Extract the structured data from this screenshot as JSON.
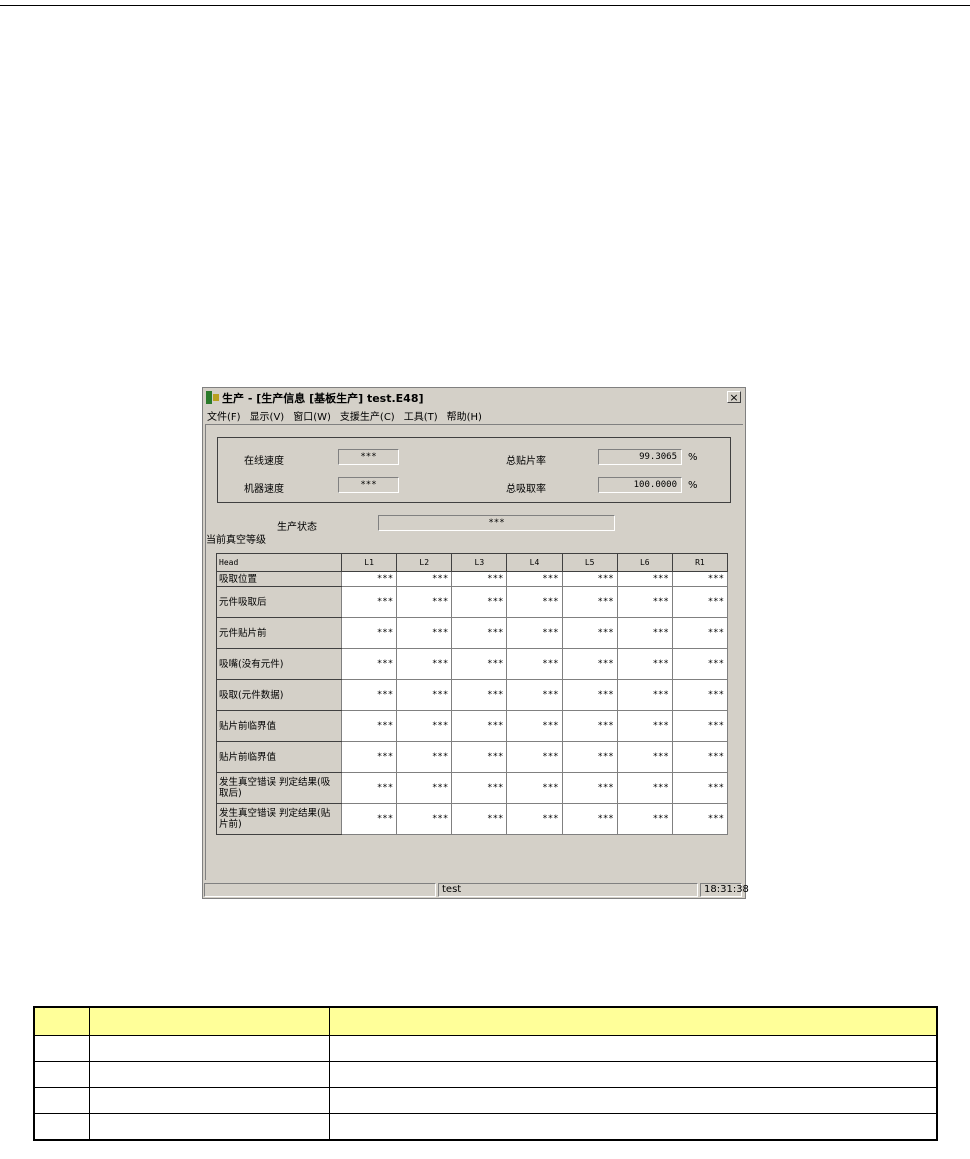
{
  "window": {
    "title": "生产 - [生产信息 [基板生产] test.E48]",
    "close_label": "×",
    "menu": [
      "文件(F)",
      "显示(V)",
      "窗口(W)",
      "支援生产(C)",
      "工具(T)",
      "帮助(H)"
    ]
  },
  "info": {
    "online_speed_label": "在线速度",
    "online_speed_value": "***",
    "machine_speed_label": "机器速度",
    "machine_speed_value": "***",
    "total_place_rate_label": "总贴片率",
    "total_place_rate_value": "99.3065",
    "total_place_rate_unit": "%",
    "total_pick_rate_label": "总吸取率",
    "total_pick_rate_value": "100.0000",
    "total_pick_rate_unit": "%",
    "production_status_label": "生产状态",
    "production_status_value": "***",
    "vacuum_level_label": "当前真空等级"
  },
  "grid": {
    "columns": [
      "Head",
      "L1",
      "L2",
      "L3",
      "L4",
      "L5",
      "L6",
      "R1"
    ],
    "rows": [
      {
        "label": "吸取位置",
        "values": [
          "***",
          "***",
          "***",
          "***",
          "***",
          "***",
          "***"
        ]
      },
      {
        "label": "元件吸取后",
        "values": [
          "***",
          "***",
          "***",
          "***",
          "***",
          "***",
          "***"
        ]
      },
      {
        "label": "元件贴片前",
        "values": [
          "***",
          "***",
          "***",
          "***",
          "***",
          "***",
          "***"
        ]
      },
      {
        "label": "吸嘴(没有元件)",
        "values": [
          "***",
          "***",
          "***",
          "***",
          "***",
          "***",
          "***"
        ]
      },
      {
        "label": "吸取(元件数据)",
        "values": [
          "***",
          "***",
          "***",
          "***",
          "***",
          "***",
          "***"
        ]
      },
      {
        "label": "贴片前临界值",
        "values": [
          "***",
          "***",
          "***",
          "***",
          "***",
          "***",
          "***"
        ]
      },
      {
        "label": "贴片前临界值",
        "values": [
          "***",
          "***",
          "***",
          "***",
          "***",
          "***",
          "***"
        ]
      },
      {
        "label": "发生真空错误 判定结果(吸取后)",
        "values": [
          "***",
          "***",
          "***",
          "***",
          "***",
          "***",
          "***"
        ]
      },
      {
        "label": "发生真空错误 判定结果(贴片前)",
        "values": [
          "***",
          "***",
          "***",
          "***",
          "***",
          "***",
          "***"
        ]
      }
    ]
  },
  "statusbar": {
    "middle": "test",
    "time": "18:31:38"
  },
  "colors": {
    "window_bg": "#d4d0c8",
    "doc_header_bg": "#ffff99"
  }
}
